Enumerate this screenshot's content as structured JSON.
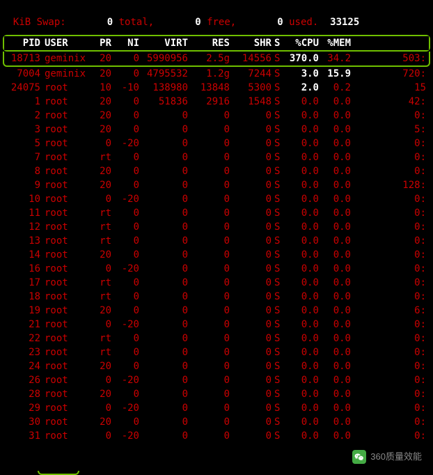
{
  "swap": {
    "label": "KiB Swap:",
    "total_val": "0",
    "total_lbl": "total,",
    "free_val": "0",
    "free_lbl": "free,",
    "used_val": "0",
    "used_lbl": "used.",
    "tail": "33125"
  },
  "headers": {
    "pid": "PID",
    "user": "USER",
    "pr": "PR",
    "ni": "NI",
    "virt": "VIRT",
    "res": "RES",
    "shr": "SHR",
    "s": "S",
    "cpu": "%CPU",
    "mem": "%MEM"
  },
  "first_row": {
    "pid": "18713",
    "user": "geminix",
    "pr": "20",
    "ni": "0",
    "virt": "5990956",
    "res": "2.5g",
    "shr": "14556",
    "s": "S",
    "cpu": "370.0",
    "mem": "34.2",
    "tail": "503:"
  },
  "rows": [
    {
      "pid": "7004",
      "user": "geminix",
      "pr": "20",
      "ni": "0",
      "virt": "4795532",
      "res": "1.2g",
      "shr": "7244",
      "s": "S",
      "cpu": "3.0",
      "mem": "15.9",
      "tail": "720:"
    },
    {
      "pid": "24075",
      "user": "root",
      "pr": "10",
      "ni": "-10",
      "virt": "138980",
      "res": "13848",
      "shr": "5300",
      "s": "S",
      "cpu": "2.0",
      "mem": "0.2",
      "tail": "15"
    },
    {
      "pid": "1",
      "user": "root",
      "pr": "20",
      "ni": "0",
      "virt": "51836",
      "res": "2916",
      "shr": "1548",
      "s": "S",
      "cpu": "0.0",
      "mem": "0.0",
      "tail": "42:"
    },
    {
      "pid": "2",
      "user": "root",
      "pr": "20",
      "ni": "0",
      "virt": "0",
      "res": "0",
      "shr": "0",
      "s": "S",
      "cpu": "0.0",
      "mem": "0.0",
      "tail": "0:"
    },
    {
      "pid": "3",
      "user": "root",
      "pr": "20",
      "ni": "0",
      "virt": "0",
      "res": "0",
      "shr": "0",
      "s": "S",
      "cpu": "0.0",
      "mem": "0.0",
      "tail": "5:"
    },
    {
      "pid": "5",
      "user": "root",
      "pr": "0",
      "ni": "-20",
      "virt": "0",
      "res": "0",
      "shr": "0",
      "s": "S",
      "cpu": "0.0",
      "mem": "0.0",
      "tail": "0:"
    },
    {
      "pid": "7",
      "user": "root",
      "pr": "rt",
      "ni": "0",
      "virt": "0",
      "res": "0",
      "shr": "0",
      "s": "S",
      "cpu": "0.0",
      "mem": "0.0",
      "tail": "0:"
    },
    {
      "pid": "8",
      "user": "root",
      "pr": "20",
      "ni": "0",
      "virt": "0",
      "res": "0",
      "shr": "0",
      "s": "S",
      "cpu": "0.0",
      "mem": "0.0",
      "tail": "0:"
    },
    {
      "pid": "9",
      "user": "root",
      "pr": "20",
      "ni": "0",
      "virt": "0",
      "res": "0",
      "shr": "0",
      "s": "S",
      "cpu": "0.0",
      "mem": "0.0",
      "tail": "128:"
    },
    {
      "pid": "10",
      "user": "root",
      "pr": "0",
      "ni": "-20",
      "virt": "0",
      "res": "0",
      "shr": "0",
      "s": "S",
      "cpu": "0.0",
      "mem": "0.0",
      "tail": "0:"
    },
    {
      "pid": "11",
      "user": "root",
      "pr": "rt",
      "ni": "0",
      "virt": "0",
      "res": "0",
      "shr": "0",
      "s": "S",
      "cpu": "0.0",
      "mem": "0.0",
      "tail": "0:"
    },
    {
      "pid": "12",
      "user": "root",
      "pr": "rt",
      "ni": "0",
      "virt": "0",
      "res": "0",
      "shr": "0",
      "s": "S",
      "cpu": "0.0",
      "mem": "0.0",
      "tail": "0:"
    },
    {
      "pid": "13",
      "user": "root",
      "pr": "rt",
      "ni": "0",
      "virt": "0",
      "res": "0",
      "shr": "0",
      "s": "S",
      "cpu": "0.0",
      "mem": "0.0",
      "tail": "0:"
    },
    {
      "pid": "14",
      "user": "root",
      "pr": "20",
      "ni": "0",
      "virt": "0",
      "res": "0",
      "shr": "0",
      "s": "S",
      "cpu": "0.0",
      "mem": "0.0",
      "tail": "0:"
    },
    {
      "pid": "16",
      "user": "root",
      "pr": "0",
      "ni": "-20",
      "virt": "0",
      "res": "0",
      "shr": "0",
      "s": "S",
      "cpu": "0.0",
      "mem": "0.0",
      "tail": "0:"
    },
    {
      "pid": "17",
      "user": "root",
      "pr": "rt",
      "ni": "0",
      "virt": "0",
      "res": "0",
      "shr": "0",
      "s": "S",
      "cpu": "0.0",
      "mem": "0.0",
      "tail": "0:"
    },
    {
      "pid": "18",
      "user": "root",
      "pr": "rt",
      "ni": "0",
      "virt": "0",
      "res": "0",
      "shr": "0",
      "s": "S",
      "cpu": "0.0",
      "mem": "0.0",
      "tail": "0:"
    },
    {
      "pid": "19",
      "user": "root",
      "pr": "20",
      "ni": "0",
      "virt": "0",
      "res": "0",
      "shr": "0",
      "s": "S",
      "cpu": "0.0",
      "mem": "0.0",
      "tail": "6:"
    },
    {
      "pid": "21",
      "user": "root",
      "pr": "0",
      "ni": "-20",
      "virt": "0",
      "res": "0",
      "shr": "0",
      "s": "S",
      "cpu": "0.0",
      "mem": "0.0",
      "tail": "0:"
    },
    {
      "pid": "22",
      "user": "root",
      "pr": "rt",
      "ni": "0",
      "virt": "0",
      "res": "0",
      "shr": "0",
      "s": "S",
      "cpu": "0.0",
      "mem": "0.0",
      "tail": "0:"
    },
    {
      "pid": "23",
      "user": "root",
      "pr": "rt",
      "ni": "0",
      "virt": "0",
      "res": "0",
      "shr": "0",
      "s": "S",
      "cpu": "0.0",
      "mem": "0.0",
      "tail": "0:"
    },
    {
      "pid": "24",
      "user": "root",
      "pr": "20",
      "ni": "0",
      "virt": "0",
      "res": "0",
      "shr": "0",
      "s": "S",
      "cpu": "0.0",
      "mem": "0.0",
      "tail": "0:"
    },
    {
      "pid": "26",
      "user": "root",
      "pr": "0",
      "ni": "-20",
      "virt": "0",
      "res": "0",
      "shr": "0",
      "s": "S",
      "cpu": "0.0",
      "mem": "0.0",
      "tail": "0:"
    },
    {
      "pid": "28",
      "user": "root",
      "pr": "20",
      "ni": "0",
      "virt": "0",
      "res": "0",
      "shr": "0",
      "s": "S",
      "cpu": "0.0",
      "mem": "0.0",
      "tail": "0:"
    },
    {
      "pid": "29",
      "user": "root",
      "pr": "0",
      "ni": "-20",
      "virt": "0",
      "res": "0",
      "shr": "0",
      "s": "S",
      "cpu": "0.0",
      "mem": "0.0",
      "tail": "0:"
    },
    {
      "pid": "30",
      "user": "root",
      "pr": "20",
      "ni": "0",
      "virt": "0",
      "res": "0",
      "shr": "0",
      "s": "S",
      "cpu": "0.0",
      "mem": "0.0",
      "tail": "0:"
    },
    {
      "pid": "31",
      "user": "root",
      "pr": "0",
      "ni": "-20",
      "virt": "0",
      "res": "0",
      "shr": "0",
      "s": "S",
      "cpu": "0.0",
      "mem": "0.0",
      "tail": "0:"
    }
  ],
  "watermark": {
    "text": "360质量效能"
  }
}
